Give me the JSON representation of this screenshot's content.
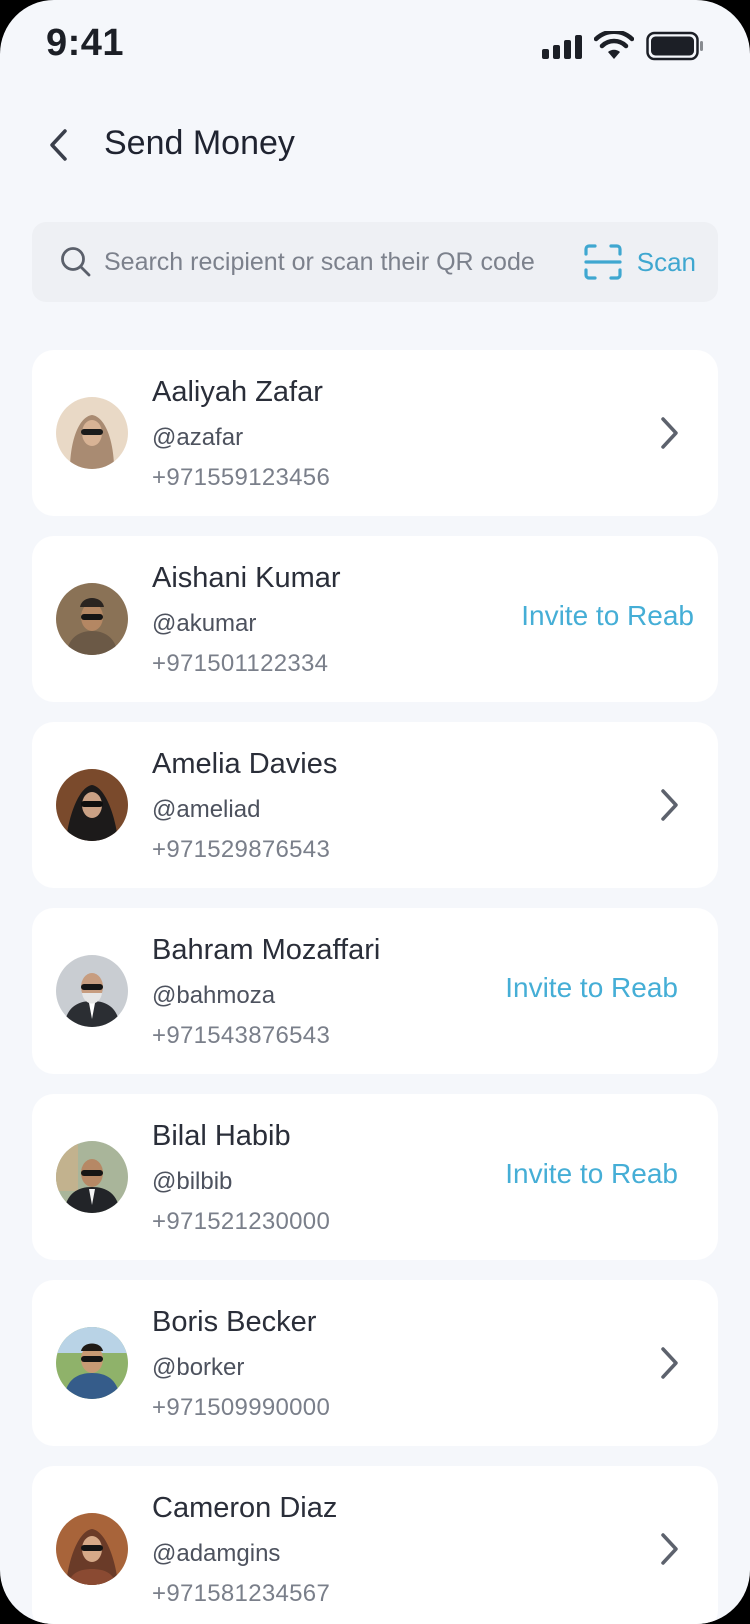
{
  "status_bar": {
    "time": "9:41"
  },
  "header": {
    "title": "Send Money"
  },
  "search": {
    "placeholder": "Search recipient or scan their QR code",
    "scan_label": "Scan"
  },
  "colors": {
    "accent": "#45aed6",
    "background": "#f5f7fb",
    "card": "#ffffff",
    "text_primary": "#2a2e39"
  },
  "contacts": [
    {
      "name": "Aaliyah Zafar",
      "handle": "@azafar",
      "phone": "+971559123456",
      "action": "chevron"
    },
    {
      "name": "Aishani Kumar",
      "handle": "@akumar",
      "phone": "+971501122334",
      "action": "invite",
      "action_label": "Invite to Reab"
    },
    {
      "name": "Amelia Davies",
      "handle": "@ameliad",
      "phone": "+971529876543",
      "action": "chevron"
    },
    {
      "name": "Bahram Mozaffari",
      "handle": "@bahmoza",
      "phone": "+971543876543",
      "action": "invite",
      "action_label": "Invite to Reab"
    },
    {
      "name": "Bilal Habib",
      "handle": "@bilbib",
      "phone": "+971521230000",
      "action": "invite",
      "action_label": "Invite to Reab"
    },
    {
      "name": "Boris Becker",
      "handle": "@borker",
      "phone": "+971509990000",
      "action": "chevron"
    },
    {
      "name": "Cameron Diaz",
      "handle": "@adamgins",
      "phone": "+971581234567",
      "action": "chevron"
    }
  ]
}
